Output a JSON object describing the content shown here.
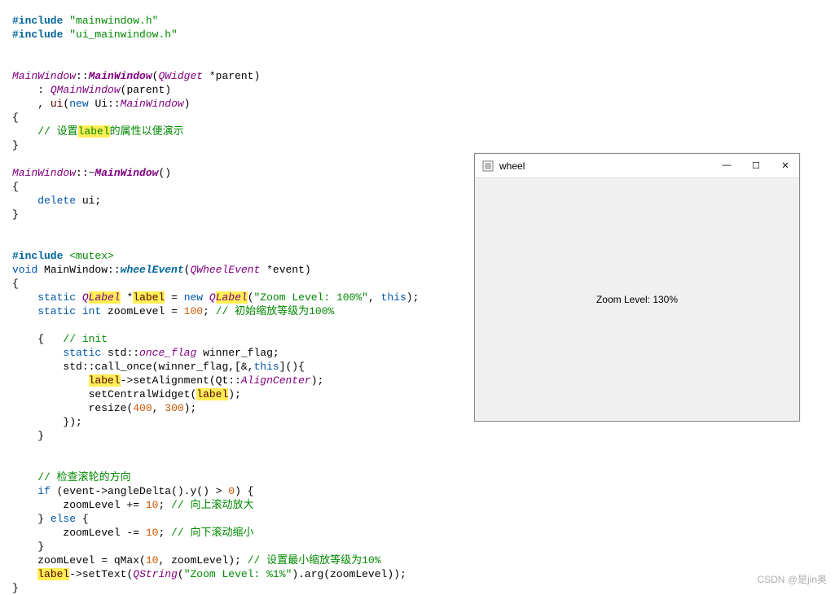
{
  "code": {
    "line1a": "#include",
    "line1b": " \"mainwindow.h\"",
    "line2a": "#include",
    "line2b": " \"ui_mainwindow.h\"",
    "line5a": "MainWindow",
    "line5b": "::",
    "line5c": "MainWindow",
    "line5d": "(",
    "line5e": "QWidget",
    "line5f": " *parent)",
    "line6a": "    : ",
    "line6b": "QMainWindow",
    "line6c": "(parent)",
    "line7a": "    , ",
    "line7b": "ui",
    "line7c": "(",
    "line7d": "new",
    "line7e": " Ui::",
    "line7f": "MainWindow",
    "line7g": ")",
    "line8": "{",
    "line9a": "    ",
    "line9b": "// 设置",
    "line9c": "label",
    "line9d": "的属性以便演示",
    "line10": "}",
    "line12a": "MainWindow",
    "line12b": "::~",
    "line12c": "MainWindow",
    "line12d": "()",
    "line13": "{",
    "line14a": "    ",
    "line14b": "delete",
    "line14c": " ui;",
    "line15": "}",
    "line18a": "#include",
    "line18b": " <mutex>",
    "line19a": "void",
    "line19b": " MainWindow::",
    "line19c": "wheelEvent",
    "line19d": "(",
    "line19e": "QWheelEvent",
    "line19f": " *event)",
    "line20": "{",
    "line21a": "    ",
    "line21b": "static",
    "line21c": " Q",
    "line21d": "Label",
    "line21e": " *",
    "line21f": "label",
    "line21g": " = ",
    "line21h": "new",
    "line21i": " Q",
    "line21j": "Label",
    "line21k": "(",
    "line21l": "\"Zoom Level: 100%\"",
    "line21m": ", ",
    "line21n": "this",
    "line21o": ");",
    "line22a": "    ",
    "line22b": "static",
    "line22c": " ",
    "line22d": "int",
    "line22e": " zoomLevel = ",
    "line22f": "100",
    "line22g": "; ",
    "line22h": "// 初始缩放等级为100%",
    "line24a": "    {   ",
    "line24b": "// init",
    "line25a": "        ",
    "line25b": "static",
    "line25c": " std::",
    "line25d": "once_flag",
    "line25e": " winner_flag;",
    "line26a": "        std::",
    "line26b": "call_once",
    "line26c": "(winner_flag,[&,",
    "line26d": "this",
    "line26e": "](){",
    "line27a": "            ",
    "line27b": "label",
    "line27c": "->",
    "line27d": "setAlignment",
    "line27e": "(Qt::",
    "line27f": "AlignCenter",
    "line27g": ");",
    "line28a": "            ",
    "line28b": "setCentralWidget",
    "line28c": "(",
    "line28d": "label",
    "line28e": ");",
    "line29a": "            ",
    "line29b": "resize",
    "line29c": "(",
    "line29d": "400",
    "line29e": ", ",
    "line29f": "300",
    "line29g": ");",
    "line30": "        });",
    "line31": "    }",
    "line34a": "    ",
    "line34b": "// 检查滚轮的方向",
    "line35a": "    ",
    "line35b": "if",
    "line35c": " (event->",
    "line35d": "angleDelta",
    "line35e": "().",
    "line35f": "y",
    "line35g": "() > ",
    "line35h": "0",
    "line35i": ") {",
    "line36a": "        zoomLevel += ",
    "line36b": "10",
    "line36c": "; ",
    "line36d": "// 向上滚动放大",
    "line37a": "    } ",
    "line37b": "else",
    "line37c": " {",
    "line38a": "        zoomLevel -= ",
    "line38b": "10",
    "line38c": "; ",
    "line38d": "// 向下滚动缩小",
    "line39": "    }",
    "line40a": "    zoomLevel = ",
    "line40b": "qMax",
    "line40c": "(",
    "line40d": "10",
    "line40e": ", zoomLevel); ",
    "line40f": "// 设置最小缩放等级为10%",
    "line41a": "    ",
    "line41b": "label",
    "line41c": "->",
    "line41d": "setText",
    "line41e": "(",
    "line41f": "QString",
    "line41g": "(",
    "line41h": "\"Zoom Level: %1%\"",
    "line41i": ").",
    "line41j": "arg",
    "line41k": "(zoomLevel));",
    "line42": "}"
  },
  "window": {
    "title": "wheel",
    "content": "Zoom Level: 130%"
  },
  "watermark": "CSDN @是jin奥"
}
